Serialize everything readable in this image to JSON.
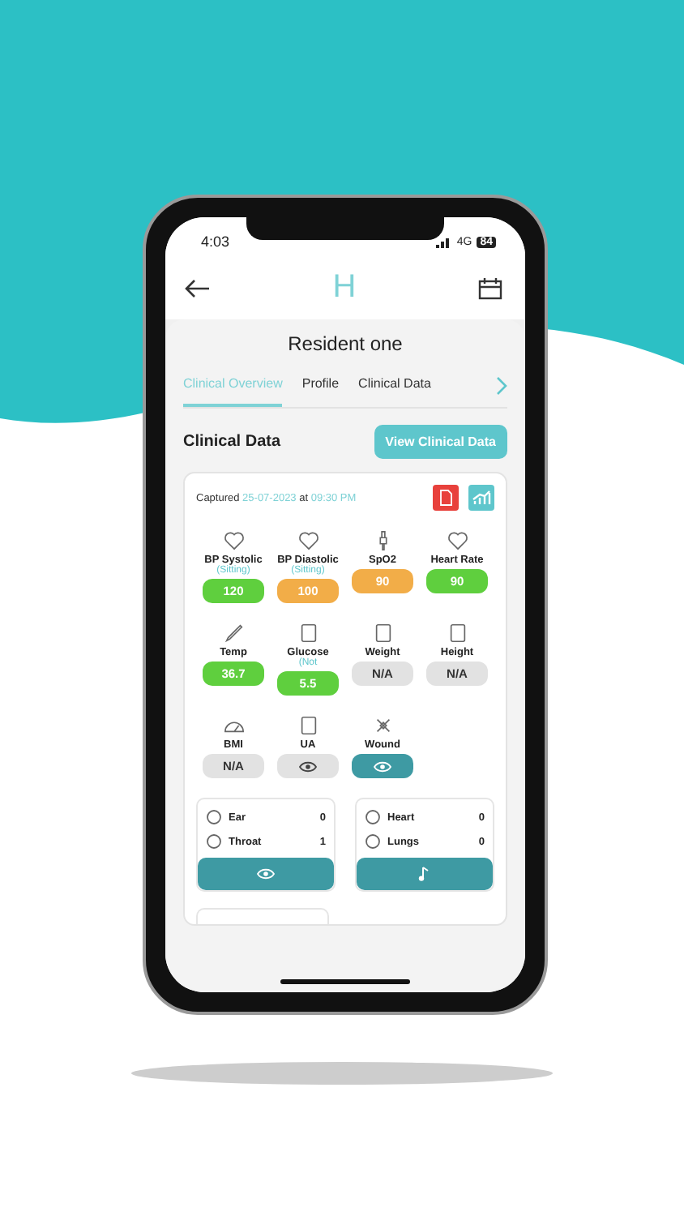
{
  "status_bar": {
    "time": "4:03",
    "network": "4G",
    "battery": "84"
  },
  "header": {
    "logo": "H"
  },
  "title": "Resident one",
  "tabs": [
    {
      "label": "Clinical Overview",
      "selected": true
    },
    {
      "label": "Profile",
      "selected": false
    },
    {
      "label": "Clinical Data",
      "selected": false
    }
  ],
  "section": {
    "title": "Clinical Data",
    "button": "View Clinical Data"
  },
  "capture": {
    "label": "Captured",
    "date": "25-07-2023",
    "at": "at",
    "time": "09:30 PM"
  },
  "vitals": [
    {
      "name": "BP Systolic",
      "sub": "(Sitting)",
      "kind": "text",
      "value": "120",
      "color": "#5fcf3e"
    },
    {
      "name": "BP Diastolic",
      "sub": "(Sitting)",
      "kind": "text",
      "value": "100",
      "color": "#f2ad48"
    },
    {
      "name": "SpO2",
      "kind": "text",
      "value": "90",
      "color": "#f2ad48"
    },
    {
      "name": "Heart Rate",
      "kind": "text",
      "value": "90",
      "color": "#5fcf3e"
    },
    {
      "name": "Temp",
      "kind": "text",
      "value": "36.7",
      "color": "#5fcf3e"
    },
    {
      "name": "Glucose",
      "sub": "(Not",
      "kind": "text",
      "value": "5.5",
      "color": "#5fcf3e"
    },
    {
      "name": "Weight",
      "kind": "text",
      "value": "N/A",
      "color": "#e2e2e2"
    },
    {
      "name": "Height",
      "kind": "text",
      "value": "N/A",
      "color": "#e2e2e2"
    },
    {
      "name": "BMI",
      "kind": "text",
      "value": "N/A",
      "color": "#e2e2e2"
    },
    {
      "name": "UA",
      "kind": "eye",
      "color": "#e2e2e2"
    },
    {
      "name": "Wound",
      "kind": "eye",
      "color": "#3e9aa3"
    }
  ],
  "exams": [
    {
      "rows": [
        {
          "name": "Ear",
          "count": "0"
        },
        {
          "name": "Throat",
          "count": "1"
        }
      ],
      "kind": "eye"
    },
    {
      "rows": [
        {
          "name": "Heart",
          "count": "0"
        },
        {
          "name": "Lungs",
          "count": "0"
        }
      ],
      "kind": "audio"
    }
  ]
}
